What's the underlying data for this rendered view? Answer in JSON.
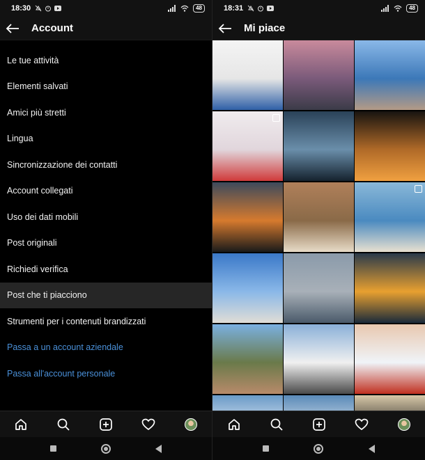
{
  "left": {
    "status": {
      "time": "18:30",
      "battery": "48"
    },
    "appbar": {
      "title": "Account"
    },
    "menu": [
      {
        "label": "Le tue attività"
      },
      {
        "label": "Elementi salvati"
      },
      {
        "label": "Amici più stretti"
      },
      {
        "label": "Lingua"
      },
      {
        "label": "Sincronizzazione dei contatti"
      },
      {
        "label": "Account collegati"
      },
      {
        "label": "Uso dei dati mobili"
      },
      {
        "label": "Post originali"
      },
      {
        "label": "Richiedi verifica"
      },
      {
        "label": "Post che ti piacciono",
        "active": true
      },
      {
        "label": "Strumenti per i contenuti brandizzati"
      },
      {
        "label": "Passa a un account aziendale",
        "link": true
      },
      {
        "label": "Passa all'account personale",
        "link": true
      }
    ]
  },
  "right": {
    "status": {
      "time": "18:31",
      "battery": "48"
    },
    "appbar": {
      "title": "Mi piace"
    },
    "photos": [
      {
        "icon": "mugs-photo",
        "colors": [
          "#f4f4f4",
          "#e6e6e6",
          "#2f5fa7"
        ],
        "multi": false
      },
      {
        "icon": "cliff-sunset-photo",
        "colors": [
          "#c98a9c",
          "#7a5a7a",
          "#3b3b48"
        ],
        "multi": false
      },
      {
        "icon": "person-rocks-sea-photo",
        "colors": [
          "#8ab8e8",
          "#3c78b8",
          "#b49a86"
        ],
        "multi": false
      },
      {
        "icon": "toys-balloons-photo",
        "colors": [
          "#f0ecee",
          "#e1d6dc",
          "#d03a3a"
        ],
        "multi": true
      },
      {
        "icon": "ice-cave-photo",
        "colors": [
          "#2a4258",
          "#6a8eaa",
          "#15222e"
        ],
        "multi": false
      },
      {
        "icon": "cave-sunset-sea-photo",
        "colors": [
          "#181410",
          "#b06a28",
          "#f0a040"
        ],
        "multi": false
      },
      {
        "icon": "sunset-sky-photo",
        "colors": [
          "#3d4a5c",
          "#d67a2e",
          "#1a1a1a"
        ],
        "multi": false
      },
      {
        "icon": "cat-face-photo",
        "colors": [
          "#b0805a",
          "#8a6a48",
          "#e8dcc8"
        ],
        "multi": false
      },
      {
        "icon": "beach-coast-photo",
        "colors": [
          "#8ab8d8",
          "#4a8ac0",
          "#e8e0d0"
        ],
        "multi": true
      },
      {
        "icon": "white-town-sea-photo",
        "colors": [
          "#3a78c8",
          "#8ab8e8",
          "#e0ddd6"
        ],
        "multi": false
      },
      {
        "icon": "sailboats-photo",
        "colors": [
          "#8a9aaa",
          "#a8b0b8",
          "#4a5a6a"
        ],
        "multi": false
      },
      {
        "icon": "lighthouse-sunset-photo",
        "colors": [
          "#2a3a4a",
          "#e8a030",
          "#1a2a3a"
        ],
        "multi": false
      },
      {
        "icon": "hill-village-photo",
        "colors": [
          "#7ab0e0",
          "#6a7a4a",
          "#b88a6a"
        ],
        "multi": false
      },
      {
        "icon": "snow-mountain-tracks-photo",
        "colors": [
          "#8ab0d8",
          "#f0f0f0",
          "#4a4a4a"
        ],
        "multi": false
      },
      {
        "icon": "snowboarder-photo",
        "colors": [
          "#e8c8b0",
          "#f0f4f8",
          "#c03020"
        ],
        "multi": false
      },
      {
        "icon": "mountain-peak-photo",
        "colors": [
          "#6a9ac8",
          "#e8eef4",
          "#4a5a6a"
        ],
        "multi": false
      },
      {
        "icon": "clouds-photo",
        "colors": [
          "#5a8ab8",
          "#e0e8f0",
          "#2a3a4a"
        ],
        "multi": false
      },
      {
        "icon": "beach-shadow-photo",
        "colors": [
          "#d8c8a8",
          "#1a1a1a",
          "#e8dcc0"
        ],
        "multi": false
      }
    ]
  }
}
